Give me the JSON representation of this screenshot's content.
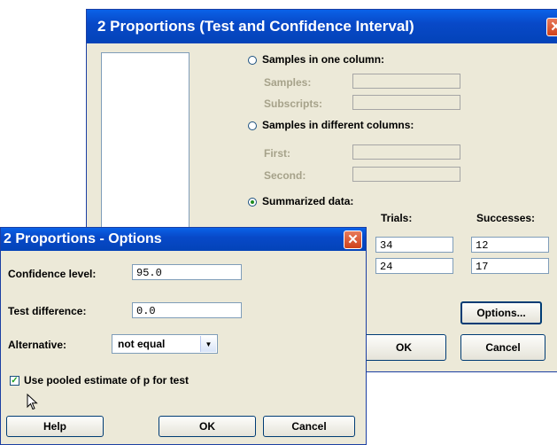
{
  "main": {
    "title": "2 Proportions (Test and Confidence Interval)",
    "radio_one_column": "Samples in one column:",
    "samples_label": "Samples:",
    "subscripts_label": "Subscripts:",
    "radio_diff_columns": "Samples in different columns:",
    "first_label": "First:",
    "second_label": "Second:",
    "radio_summarized": "Summarized data:",
    "trials_header": "Trials:",
    "successes_header": "Successes:",
    "trials": [
      "34",
      "24"
    ],
    "successes": [
      "12",
      "17"
    ],
    "options_button": "Options...",
    "ok_button": "OK",
    "cancel_button": "Cancel",
    "selected_option": "Summarized data"
  },
  "options": {
    "title": "2 Proportions - Options",
    "confidence_label": "Confidence level:",
    "confidence_value": "95.0",
    "test_diff_label": "Test difference:",
    "test_diff_value": "0.0",
    "alternative_label": "Alternative:",
    "alternative_value": "not equal",
    "pooled_label": "Use pooled estimate of p for test",
    "pooled_checked": true,
    "help_button": "Help",
    "ok_button": "OK",
    "cancel_button": "Cancel"
  },
  "icons": {
    "close": "close-icon",
    "cursor": "mouse-pointer-icon",
    "dropdown": "chevron-down-icon"
  },
  "colors": {
    "title_bar": "#0849c8",
    "close_button": "#d0421a",
    "dialog_bg": "#ece9d8"
  }
}
